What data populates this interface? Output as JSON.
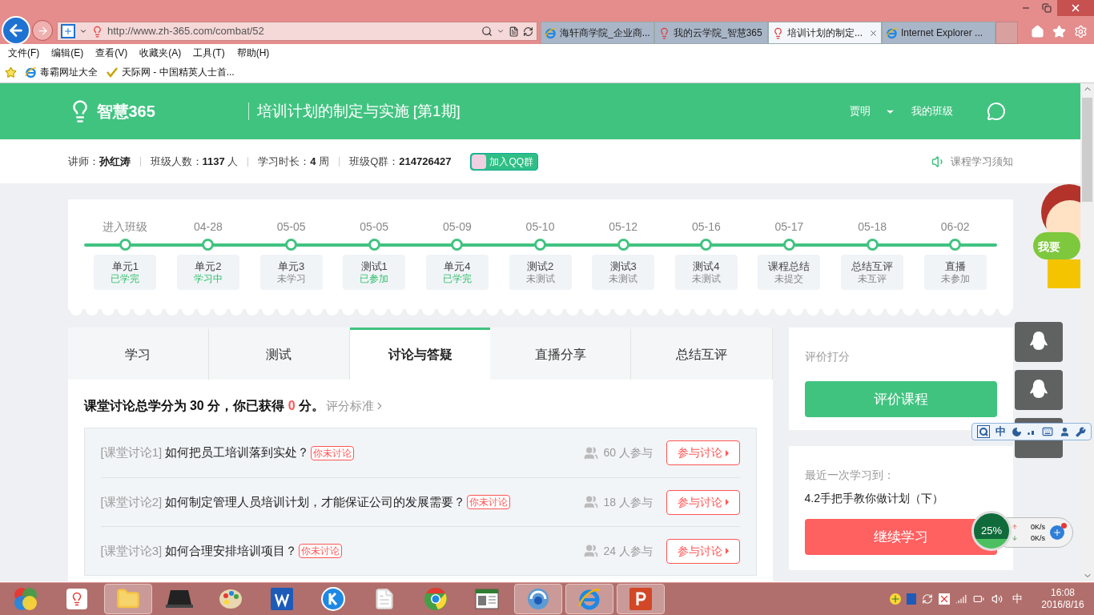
{
  "browser": {
    "address": "http://www.zh-365.com/combat/52",
    "tabs": [
      {
        "title": "海轩商学院_企业商...",
        "selected": false,
        "kind": "ie"
      },
      {
        "title": "我的云学院_智慧365",
        "selected": false,
        "kind": "bulb"
      },
      {
        "title": "培训计划的制定...",
        "selected": true,
        "kind": "bulb"
      },
      {
        "title": "Internet Explorer ...",
        "selected": false,
        "kind": "ie"
      }
    ],
    "menu": [
      "文件(F)",
      "编辑(E)",
      "查看(V)",
      "收藏夹(A)",
      "工具(T)",
      "帮助(H)"
    ],
    "favorites": [
      {
        "title": "毒霸网址大全",
        "kind": "ie"
      },
      {
        "title": "天际网 - 中国精英人士首...",
        "kind": "check"
      }
    ]
  },
  "header": {
    "logo": "智慧365",
    "course_title": "培训计划的制定与实施 [第1期]",
    "user": "贾明",
    "my_class": "我的班级"
  },
  "info": {
    "items": [
      {
        "label": "讲师：",
        "value": "孙红涛"
      },
      {
        "label": "班级人数：",
        "value": "1137",
        "unit": "人"
      },
      {
        "label": "学习时长：",
        "value": "4",
        "unit": "周"
      },
      {
        "label": "班级Q群：",
        "value": "214726427"
      }
    ],
    "qq_button": "加入QQ群",
    "notice": "课程学习须知"
  },
  "timeline": [
    {
      "date": "进入班级",
      "name": "单元1",
      "status": "已学完",
      "done": true
    },
    {
      "date": "04-28",
      "name": "单元2",
      "status": "学习中",
      "done": true
    },
    {
      "date": "05-05",
      "name": "单元3",
      "status": "未学习",
      "done": false
    },
    {
      "date": "05-05",
      "name": "测试1",
      "status": "已参加",
      "done": true
    },
    {
      "date": "05-09",
      "name": "单元4",
      "status": "已学完",
      "done": true
    },
    {
      "date": "05-10",
      "name": "测试2",
      "status": "未测试",
      "done": false
    },
    {
      "date": "05-12",
      "name": "测试3",
      "status": "未测试",
      "done": false
    },
    {
      "date": "05-16",
      "name": "测试4",
      "status": "未测试",
      "done": false
    },
    {
      "date": "05-17",
      "name": "课程总结",
      "status": "未提交",
      "done": false
    },
    {
      "date": "05-18",
      "name": "总结互评",
      "status": "未互评",
      "done": false
    },
    {
      "date": "06-02",
      "name": "直播",
      "status": "未参加",
      "done": false
    }
  ],
  "tabs": [
    {
      "label": "学习",
      "selected": false
    },
    {
      "label": "测试",
      "selected": false
    },
    {
      "label": "讨论与答疑",
      "selected": true
    },
    {
      "label": "直播分享",
      "selected": false
    },
    {
      "label": "总结互评",
      "selected": false
    }
  ],
  "summary": {
    "text": "课堂讨论总学分为 **30** 分，你已获得",
    "earned": "0",
    "unit": "分。",
    "criteria_link": "评分标准"
  },
  "discussions": [
    {
      "prefix": "[课堂讨论1]",
      "title": "如何把员工培训落到实处？",
      "tag": "你未讨论",
      "count": "60 人参与",
      "button": "参与讨论"
    },
    {
      "prefix": "[课堂讨论2]",
      "title": "如何制定管理人员培训计划，才能保证公司的发展需要？",
      "tag": "你未讨论",
      "count": "18 人参与",
      "button": "参与讨论"
    },
    {
      "prefix": "[课堂讨论3]",
      "title": "如何合理安排培训项目？",
      "tag": "你未讨论",
      "count": "24 人参与",
      "button": "参与讨论"
    }
  ],
  "rating": {
    "label": "评价打分",
    "button": "评价课程"
  },
  "recent": {
    "label": "最近一次学习到：",
    "lesson": "4.2手把手教你做计划（下）",
    "button": "继续学习"
  },
  "mascot_text": "我要",
  "ime": {
    "mode": "中"
  },
  "net_widget": {
    "percent": "25%",
    "up": "0K/s",
    "down": "0K/s"
  },
  "taskbar": {
    "apps": [
      {
        "kind": "start",
        "active": false
      },
      {
        "kind": "bulb",
        "active": false
      },
      {
        "kind": "folder",
        "active": true
      },
      {
        "kind": "laptop",
        "active": false
      },
      {
        "kind": "paint",
        "active": false
      },
      {
        "kind": "word",
        "active": false
      },
      {
        "kind": "k",
        "active": false
      },
      {
        "kind": "doc",
        "active": false
      },
      {
        "kind": "chrome",
        "active": false
      },
      {
        "kind": "window",
        "active": false
      },
      {
        "kind": "swirl",
        "active": true
      },
      {
        "kind": "ie",
        "active": true
      },
      {
        "kind": "ppt",
        "active": true
      }
    ],
    "ime": "中",
    "time": "16:08",
    "date": "2016/8/16"
  }
}
